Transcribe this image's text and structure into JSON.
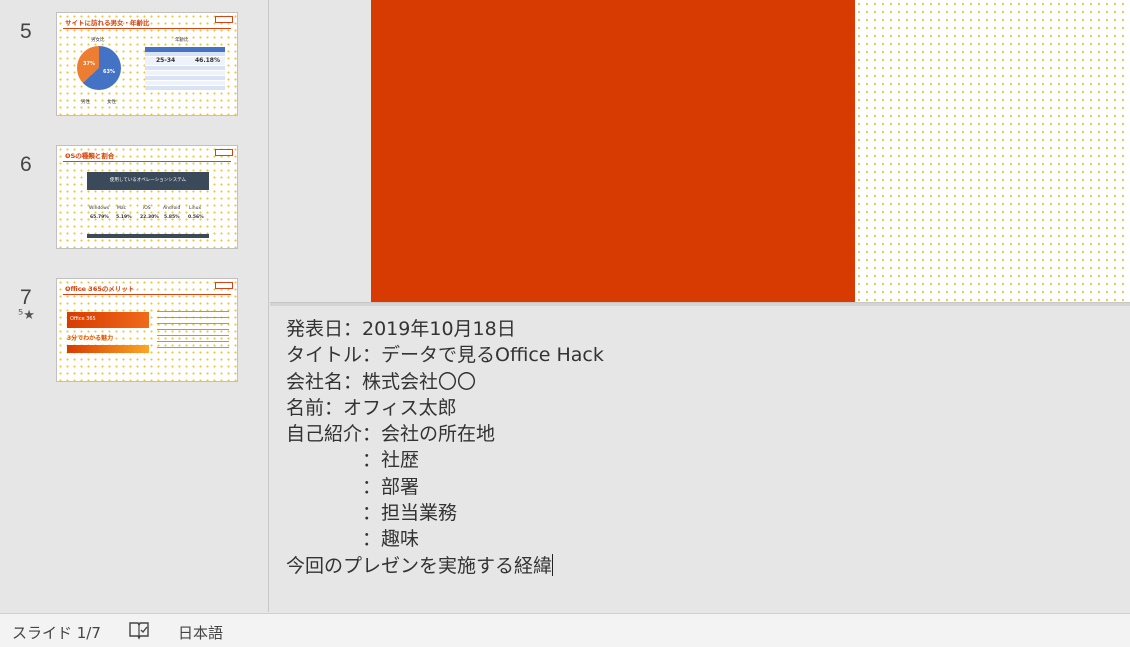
{
  "thumbnails": [
    {
      "number": "5",
      "title": "サイトに訪れる男女・年齢比",
      "left_heading": "男女比",
      "right_heading": "年齢比",
      "pie_values": [
        "37%",
        "63%"
      ],
      "table_highlight": "25-34",
      "table_value": "46.18%",
      "legend": [
        "男性",
        "女性"
      ]
    },
    {
      "number": "6",
      "title": "OSの種類と割合",
      "box_label": "使用しているオペレーションシステム",
      "os_names": [
        "Windows",
        "Mac",
        "iOS",
        "Android",
        "Linux"
      ],
      "os_values": [
        "65.79%",
        "5.19%",
        "22.30%",
        "5.85%",
        "0.56%"
      ]
    },
    {
      "number": "7",
      "title": "Office 365のメリット",
      "banner": "Office 365",
      "subtitle": "3分でわかる魅力",
      "anim_icon": "star-animation-icon"
    }
  ],
  "notes": [
    "発表日：2019年10月18日",
    "タイトル：データで見るOffice Hack",
    "会社名：株式会社〇〇",
    "名前：オフィス太郎",
    "自己紹介：会社の所在地",
    "　　　　：社歴",
    "　　　　：部署",
    "　　　　：担当業務",
    "　　　　：趣味",
    "今回のプレゼンを実施する経緯"
  ],
  "status": {
    "slide_indicator": "スライド 1/7",
    "accessibility_icon": "book-check-icon",
    "language": "日本語"
  },
  "colors": {
    "accent": "#d83b01",
    "dots": "#f2c230",
    "pie_blue": "#4472c4",
    "pie_orange": "#ed7d31"
  }
}
